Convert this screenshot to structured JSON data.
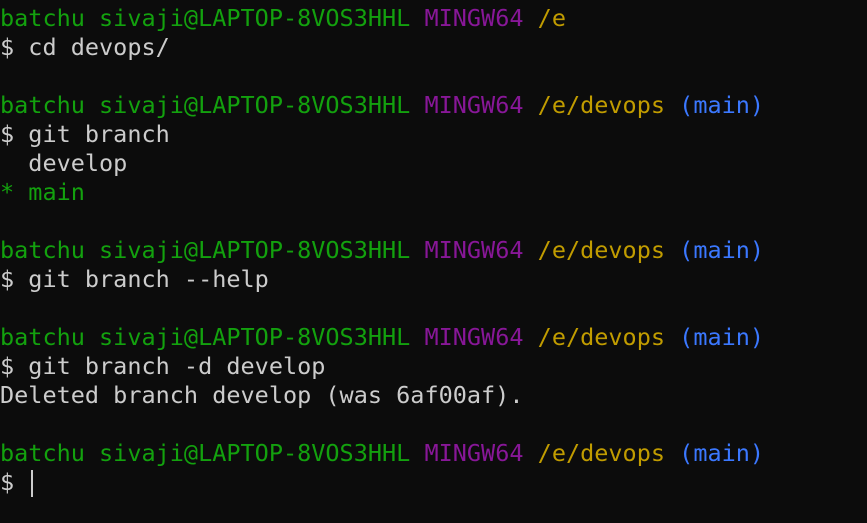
{
  "prompt": {
    "user_host": "batchu sivaji@LAPTOP-8VOS3HHL",
    "system": "MINGW64"
  },
  "blocks": [
    {
      "path": "/e",
      "branch": "",
      "command": "$ cd devops/",
      "output": []
    },
    {
      "path": "/e/devops",
      "branch": "(main)",
      "command": "$ git branch",
      "output": [
        "  develop",
        "* main"
      ]
    },
    {
      "path": "/e/devops",
      "branch": "(main)",
      "command": "$ git branch --help",
      "output": []
    },
    {
      "path": "/e/devops",
      "branch": "(main)",
      "command": "$ git branch -d develop",
      "output": [
        "Deleted branch develop (was 6af00af)."
      ]
    },
    {
      "path": "/e/devops",
      "branch": "(main)",
      "command": "$ ",
      "output": []
    }
  ],
  "colors": {
    "background": "#0c0c0c",
    "text": "#cccccc",
    "user_host": "#13a10e",
    "system": "#881798",
    "path": "#c19c00",
    "branch": "#3b78ff"
  }
}
